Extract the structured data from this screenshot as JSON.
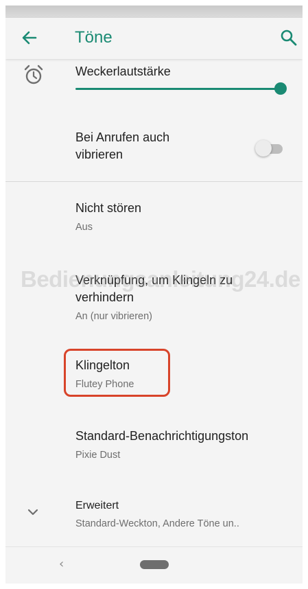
{
  "appbar": {
    "title": "Töne",
    "back_icon": "arrow-left-icon",
    "search_icon": "search-icon"
  },
  "alarm_volume": {
    "icon": "alarm-clock-icon",
    "label": "Weckerlautstärke",
    "value_fraction": 1.0
  },
  "vibrate_on_call": {
    "label_line1": "Bei Anrufen auch",
    "label_line2": "vibrieren",
    "enabled": false
  },
  "do_not_disturb": {
    "label": "Nicht stören",
    "summary": "Aus"
  },
  "prevent_ringing": {
    "label_line1": "Verknüpfung, um Klingeln zu",
    "label_line2": "verhindern",
    "summary": "An (nur vibrieren)"
  },
  "ringtone": {
    "label": "Klingelton",
    "summary": "Flutey Phone"
  },
  "notification_sound": {
    "label": "Standard-Benachrichtigungston",
    "summary": "Pixie Dust"
  },
  "advanced": {
    "icon": "chevron-down-icon",
    "label": "Erweitert",
    "summary": "Standard-Weckton, Andere Töne un.."
  },
  "watermark": {
    "text": "Bedienungsanleitung24.de"
  },
  "navbar": {
    "back_glyph": "‹"
  },
  "colors": {
    "accent": "#1a8a73",
    "highlight": "#d8442a",
    "background": "#f4f4f4"
  }
}
